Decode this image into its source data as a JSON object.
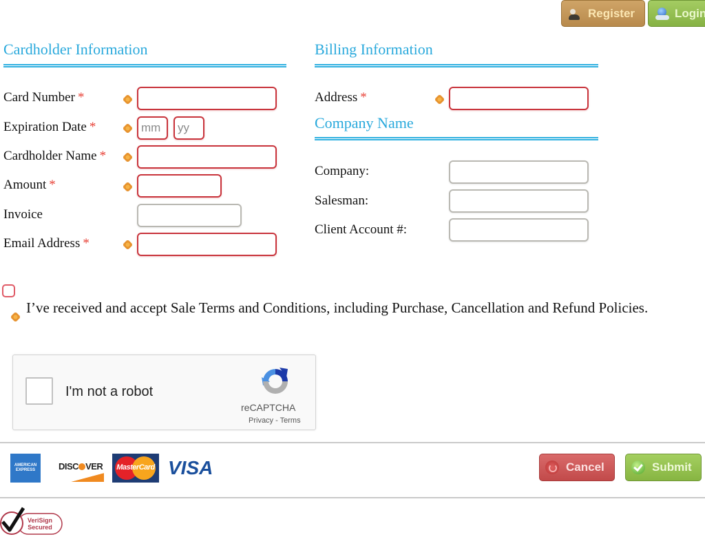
{
  "header": {
    "register_label": "Register",
    "login_label": "Login"
  },
  "cardholder": {
    "title": "Cardholder Information",
    "fields": [
      {
        "label": "Card Number",
        "required": true,
        "value": ""
      },
      {
        "label": "Expiration Date",
        "required": true,
        "month_placeholder": "mm",
        "year_placeholder": "yy"
      },
      {
        "label": "Cardholder Name",
        "required": true,
        "value": ""
      },
      {
        "label": "Amount",
        "required": true,
        "value": ""
      },
      {
        "label": "Invoice",
        "required": false,
        "value": ""
      },
      {
        "label": "Email Address",
        "required": true,
        "value": ""
      }
    ]
  },
  "billing": {
    "title": "Billing Information",
    "fields": [
      {
        "label": "Address",
        "required": true,
        "value": ""
      }
    ]
  },
  "company": {
    "title": "Company Name",
    "fields": [
      {
        "label": "Company:",
        "value": ""
      },
      {
        "label": "Salesman:",
        "value": ""
      },
      {
        "label": "Client Account #:",
        "value": ""
      }
    ]
  },
  "required_marker": "*",
  "terms": {
    "checked": false,
    "text": "I’ve received and accept Sale Terms and Conditions, including Purchase, Cancellation and Refund Policies."
  },
  "recaptcha": {
    "label": "I'm not a robot",
    "brand": "reCAPTCHA",
    "links": "Privacy - Terms",
    "checked": false
  },
  "payment_cards": {
    "amex": "AMERICAN EXPRESS",
    "discover_pre": "DISC",
    "discover_post": "VER",
    "mastercard": "MasterCard",
    "visa": "VISA"
  },
  "actions": {
    "cancel_label": "Cancel",
    "submit_label": "Submit"
  },
  "seal": {
    "line1": "VeriSign",
    "line2": "Secured"
  },
  "colors": {
    "section_title": "#29a9dc",
    "required_border": "#c8333b",
    "required_asterisk": "#e8443a",
    "register_bg": "#c59a5e",
    "login_bg": "#96c052",
    "cancel_bg": "#cf5b5b",
    "submit_bg": "#97c34f"
  }
}
